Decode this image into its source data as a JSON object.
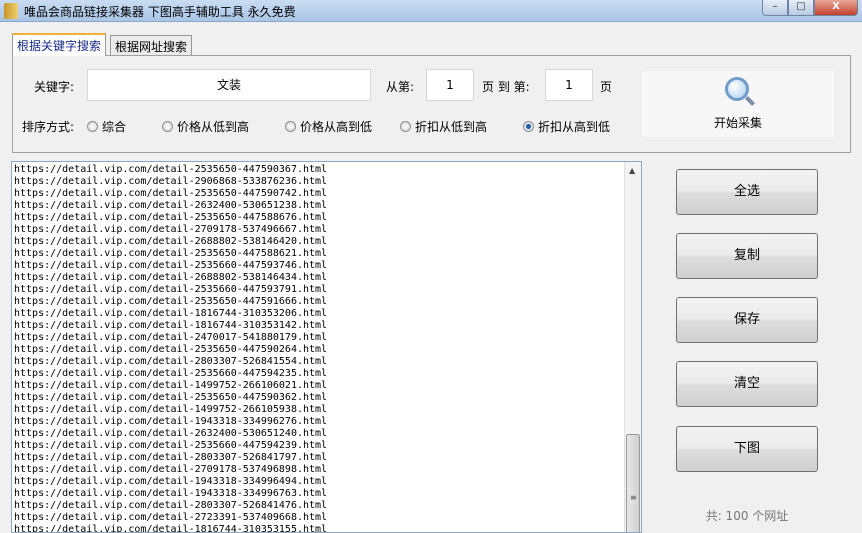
{
  "window": {
    "title": "唯品会商品链接采集器 下图高手辅助工具 永久免费",
    "minimize": "–",
    "maximize": "□",
    "close": "X"
  },
  "tabs": [
    {
      "label": "根据关键字搜索",
      "active": true
    },
    {
      "label": "根据网址搜索",
      "active": false
    }
  ],
  "search": {
    "keyword_label": "关键字:",
    "keyword_value": "文装",
    "from_label": "从第:",
    "from_value": "1",
    "to_label": "页 到 第:",
    "to_value": "1",
    "page_label": "页",
    "sort_label": "排序方式:",
    "sort_options": [
      {
        "label": "综合",
        "checked": false
      },
      {
        "label": "价格从低到高",
        "checked": false
      },
      {
        "label": "价格从高到低",
        "checked": false
      },
      {
        "label": "折扣从低到高",
        "checked": false
      },
      {
        "label": "折扣从高到低",
        "checked": true
      }
    ],
    "start_label": "开始采集"
  },
  "urls": [
    "https://detail.vip.com/detail-2535650-447590367.html",
    "https://detail.vip.com/detail-2906868-533876236.html",
    "https://detail.vip.com/detail-2535650-447590742.html",
    "https://detail.vip.com/detail-2632400-530651238.html",
    "https://detail.vip.com/detail-2535650-447588676.html",
    "https://detail.vip.com/detail-2709178-537496667.html",
    "https://detail.vip.com/detail-2688802-538146420.html",
    "https://detail.vip.com/detail-2535650-447588621.html",
    "https://detail.vip.com/detail-2535660-447593746.html",
    "https://detail.vip.com/detail-2688802-538146434.html",
    "https://detail.vip.com/detail-2535660-447593791.html",
    "https://detail.vip.com/detail-2535650-447591666.html",
    "https://detail.vip.com/detail-1816744-310353206.html",
    "https://detail.vip.com/detail-1816744-310353142.html",
    "https://detail.vip.com/detail-2470017-541880179.html",
    "https://detail.vip.com/detail-2535650-447590264.html",
    "https://detail.vip.com/detail-2803307-526841554.html",
    "https://detail.vip.com/detail-2535660-447594235.html",
    "https://detail.vip.com/detail-1499752-266106021.html",
    "https://detail.vip.com/detail-2535650-447590362.html",
    "https://detail.vip.com/detail-1499752-266105938.html",
    "https://detail.vip.com/detail-1943318-334996276.html",
    "https://detail.vip.com/detail-2632400-530651240.html",
    "https://detail.vip.com/detail-2535660-447594239.html",
    "https://detail.vip.com/detail-2803307-526841797.html",
    "https://detail.vip.com/detail-2709178-537496898.html",
    "https://detail.vip.com/detail-1943318-334996494.html",
    "https://detail.vip.com/detail-1943318-334996763.html",
    "https://detail.vip.com/detail-2803307-526841476.html",
    "https://detail.vip.com/detail-2723391-537409668.html",
    "https://detail.vip.com/detail-1816744-310353155.html"
  ],
  "actions": {
    "select_all": "全选",
    "copy": "复制",
    "save": "保存",
    "clear": "清空",
    "download": "下图"
  },
  "count_text": "共: 100 个网址"
}
